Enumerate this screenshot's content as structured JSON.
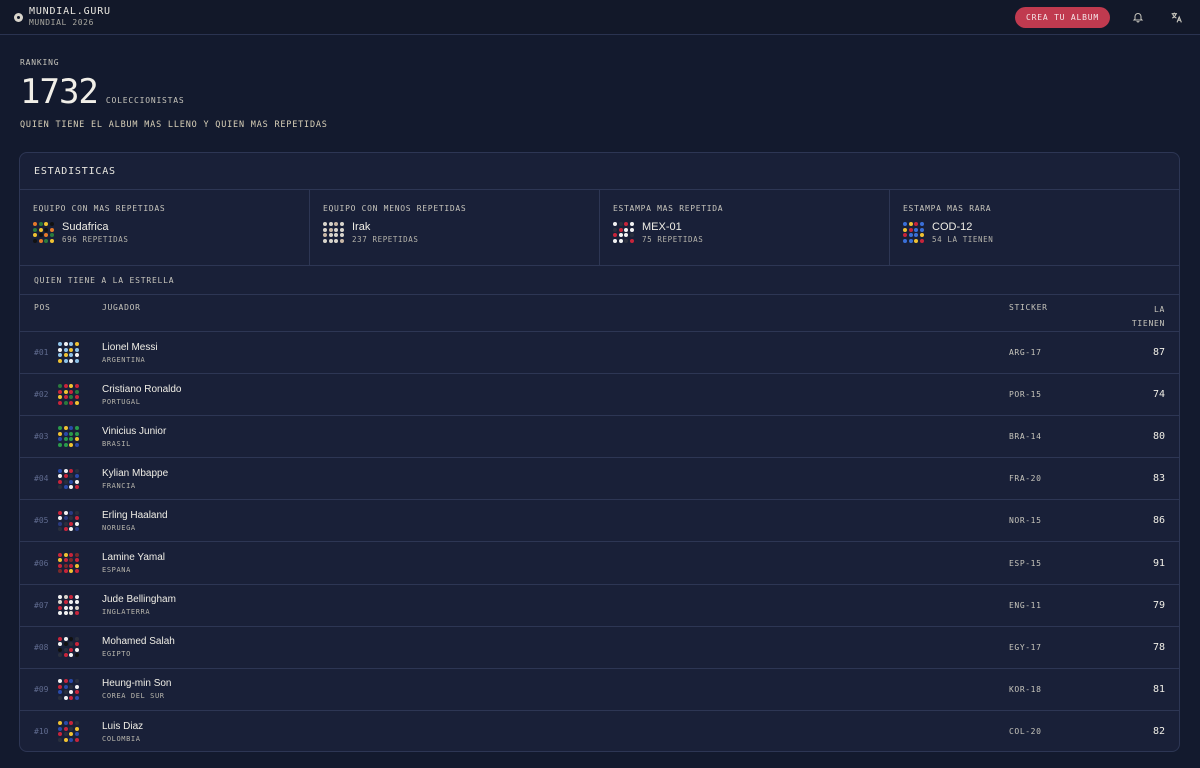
{
  "brand": {
    "name": "MUNDIAL.GURU",
    "sub": "MUNDIAL 2026",
    "icon": "soccer-ball-icon"
  },
  "topbar": {
    "cta": "CREA TU ALBUM",
    "bell_icon": "bell-icon",
    "translate_icon": "translate-icon"
  },
  "hero": {
    "label": "RANKING",
    "count": "1732",
    "count_unit": "COLECCIONISTAS",
    "description": "QUIEN TIENE EL ALBUM MAS LLENO Y QUIEN MAS REPETIDAS"
  },
  "stats": {
    "title": "ESTADISTICAS",
    "cards": [
      {
        "label": "EQUIPO CON MAS REPETIDAS",
        "name": "Sudafrica",
        "sub": "696 REPETIDAS",
        "colors": [
          "#e5792c",
          "#2a7a3d",
          "#f0c232",
          "#111111"
        ]
      },
      {
        "label": "EQUIPO CON MENOS REPETIDAS",
        "name": "Irak",
        "sub": "237 REPETIDAS",
        "colors": [
          "#d9d5cc",
          "#d9d5cc",
          "#c9b7a6",
          "#d9d5cc"
        ]
      },
      {
        "label": "ESTAMPA MAS REPETIDA",
        "name": "MEX-01",
        "sub": "75 REPETIDAS",
        "colors": [
          "#f2f2f2",
          "#2a2f3d",
          "#c7243a",
          "#f2f2f2"
        ]
      },
      {
        "label": "ESTAMPA MAS RARA",
        "name": "COD-12",
        "sub": "54 LA TIENEN",
        "colors": [
          "#3a6fd8",
          "#f0c232",
          "#c7243a",
          "#3a6fd8"
        ]
      }
    ]
  },
  "ranking": {
    "subtitle": "QUIEN TIENE A LA ESTRELLA",
    "headers": {
      "pos": "POS",
      "player": "JUGADOR",
      "sticker": "STICKER",
      "have": "LA TIENEN"
    },
    "rows": [
      {
        "pos": "#01",
        "name": "Lionel Messi",
        "country": "ARGENTINA",
        "sticker": "ARG-17",
        "have": "87",
        "colors": [
          "#8fc3ea",
          "#f2f2f2",
          "#8fc3ea",
          "#f0c232"
        ]
      },
      {
        "pos": "#02",
        "name": "Cristiano Ronaldo",
        "country": "PORTUGAL",
        "sticker": "POR-15",
        "have": "74",
        "colors": [
          "#2a7a3d",
          "#c7243a",
          "#f0c232",
          "#c7243a"
        ]
      },
      {
        "pos": "#03",
        "name": "Vinicius Junior",
        "country": "BRASIL",
        "sticker": "BRA-14",
        "have": "80",
        "colors": [
          "#2a9a4a",
          "#f0c232",
          "#2a4aa8",
          "#2a9a4a"
        ]
      },
      {
        "pos": "#04",
        "name": "Kylian Mbappe",
        "country": "FRANCIA",
        "sticker": "FRA-20",
        "have": "83",
        "colors": [
          "#2a4aa8",
          "#f2f2f2",
          "#c7243a",
          "#2a2f3d"
        ]
      },
      {
        "pos": "#05",
        "name": "Erling Haaland",
        "country": "NORUEGA",
        "sticker": "NOR-15",
        "have": "86",
        "colors": [
          "#c7243a",
          "#f2f2f2",
          "#2a3a80",
          "#2a2f3d"
        ]
      },
      {
        "pos": "#06",
        "name": "Lamine Yamal",
        "country": "ESPANA",
        "sticker": "ESP-15",
        "have": "91",
        "colors": [
          "#c7243a",
          "#f0c232",
          "#c7243a",
          "#7a2a2a"
        ]
      },
      {
        "pos": "#07",
        "name": "Jude Bellingham",
        "country": "INGLATERRA",
        "sticker": "ENG-11",
        "have": "79",
        "colors": [
          "#f2f2f2",
          "#d9d5cc",
          "#c7243a",
          "#f2f2f2"
        ]
      },
      {
        "pos": "#08",
        "name": "Mohamed Salah",
        "country": "EGIPTO",
        "sticker": "EGY-17",
        "have": "78",
        "colors": [
          "#c7243a",
          "#f2f2f2",
          "#111111",
          "#2a2f3d"
        ]
      },
      {
        "pos": "#09",
        "name": "Heung-min Son",
        "country": "COREA DEL SUR",
        "sticker": "KOR-18",
        "have": "81",
        "colors": [
          "#f2f2f2",
          "#c7243a",
          "#2a4aa8",
          "#2a2f3d"
        ]
      },
      {
        "pos": "#10",
        "name": "Luis Diaz",
        "country": "COLOMBIA",
        "sticker": "COL-20",
        "have": "82",
        "colors": [
          "#f0c232",
          "#2a4aa8",
          "#c7243a",
          "#2a2f3d"
        ]
      }
    ]
  }
}
